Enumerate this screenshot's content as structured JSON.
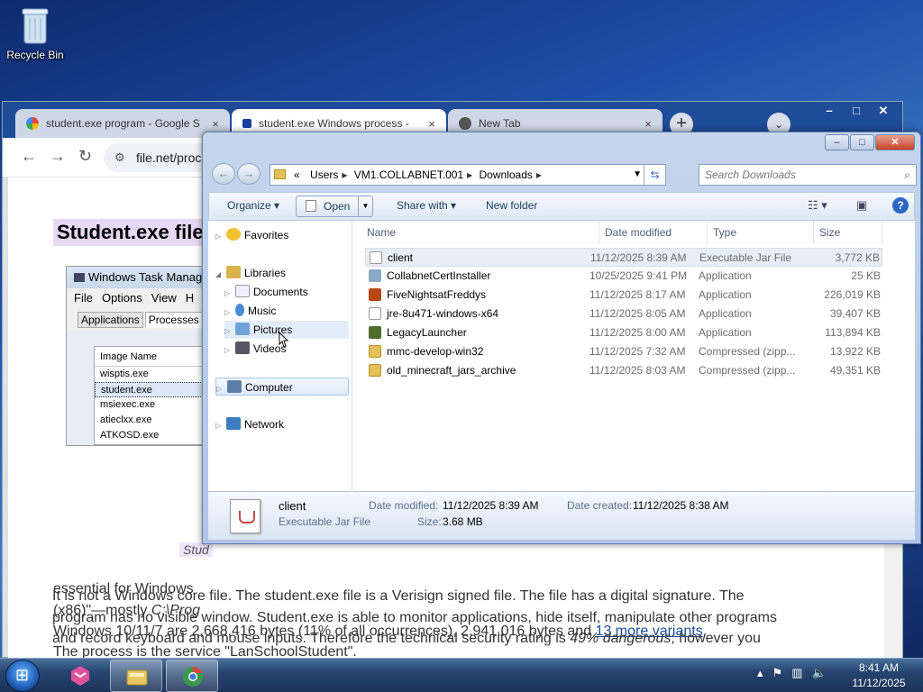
{
  "desktop": {
    "recycle_bin_label": "Recycle Bin"
  },
  "browser": {
    "tabs": [
      {
        "title": "student.exe program - Google S",
        "close": "×"
      },
      {
        "title": "student.exe Windows process -",
        "close": "×"
      },
      {
        "title": "New Tab",
        "close": "×"
      }
    ],
    "new_tab": "+",
    "address": "file.net/proc",
    "page": {
      "heading": "Student.exe file",
      "task_manager": {
        "title": "Windows Task Manager",
        "menu": [
          "File",
          "Options",
          "View",
          "H"
        ],
        "tabs": [
          "Applications",
          "Processes"
        ],
        "column": "Image Name",
        "rows": [
          "wisptis.exe",
          "student.exe",
          "msiexec.exe",
          "atieclxx.exe",
          "ATKOSD.exe"
        ]
      },
      "caption": "Stud",
      "line1": "essential for Windows",
      "line2a": "(x86)\"—mostly ",
      "line2b": "C:\\Prog",
      "line3a": "Windows 10/11/7 are 2,668,416 bytes (11% of all occurrences), 2,941,016 bytes and ",
      "line3link": "13 more variants",
      "line3b": ".",
      "line4": "The process is the service \"LanSchoolStudent\".",
      "line5": "It is not a Windows core file. The student.exe file is a Verisign signed file. The file has a digital signature. The",
      "line6": "program has no visible window. Student.exe is able to monitor applications, hide itself, manipulate other programs",
      "line7": "and record keyboard and mouse inputs. Therefore the technical security rating is ",
      "line7i": "49% dangerous",
      "line7b": "; however you"
    }
  },
  "explorer": {
    "breadcrumb": [
      "«",
      "Users",
      "VM1.COLLABNET.001",
      "Downloads"
    ],
    "search_placeholder": "Search Downloads",
    "commands": {
      "organize": "Organize",
      "open": "Open",
      "share": "Share with",
      "new_folder": "New folder"
    },
    "nav": {
      "favorites": "Favorites",
      "libraries": "Libraries",
      "documents": "Documents",
      "music": "Music",
      "pictures": "Pictures",
      "videos": "Videos",
      "computer": "Computer",
      "network": "Network"
    },
    "columns": [
      "Name",
      "Date modified",
      "Type",
      "Size"
    ],
    "files": [
      {
        "name": "client",
        "date": "11/12/2025 8:39 AM",
        "type": "Executable Jar File",
        "size": "3,772 KB",
        "icon": "jar-icon"
      },
      {
        "name": "CollabnetCertInstaller",
        "date": "10/25/2025 9:41 PM",
        "type": "Application",
        "size": "25 KB",
        "icon": "installer-icon"
      },
      {
        "name": "FiveNightsatFreddys",
        "date": "11/12/2025 8:17 AM",
        "type": "Application",
        "size": "226,019 KB",
        "icon": "game-icon"
      },
      {
        "name": "jre-8u471-windows-x64",
        "date": "11/12/2025 8:05 AM",
        "type": "Application",
        "size": "39,407 KB",
        "icon": "java-icon"
      },
      {
        "name": "LegacyLauncher",
        "date": "11/12/2025 8:00 AM",
        "type": "Application",
        "size": "113,894 KB",
        "icon": "launcher-icon"
      },
      {
        "name": "mmc-develop-win32",
        "date": "11/12/2025 7:32 AM",
        "type": "Compressed (zipp...",
        "size": "13,922 KB",
        "icon": "zip-icon"
      },
      {
        "name": "old_minecraft_jars_archive",
        "date": "11/12/2025 8:03 AM",
        "type": "Compressed (zipp...",
        "size": "49,351 KB",
        "icon": "zip-icon"
      }
    ],
    "details": {
      "name": "client",
      "type": "Executable Jar File",
      "modified_label": "Date modified:",
      "modified": "11/12/2025 8:39 AM",
      "created_label": "Date created:",
      "created": "11/12/2025 8:38 AM",
      "size_label": "Size:",
      "size": "3.68 MB"
    }
  },
  "taskbar": {
    "time": "8:41 AM",
    "date": "11/12/2025"
  }
}
